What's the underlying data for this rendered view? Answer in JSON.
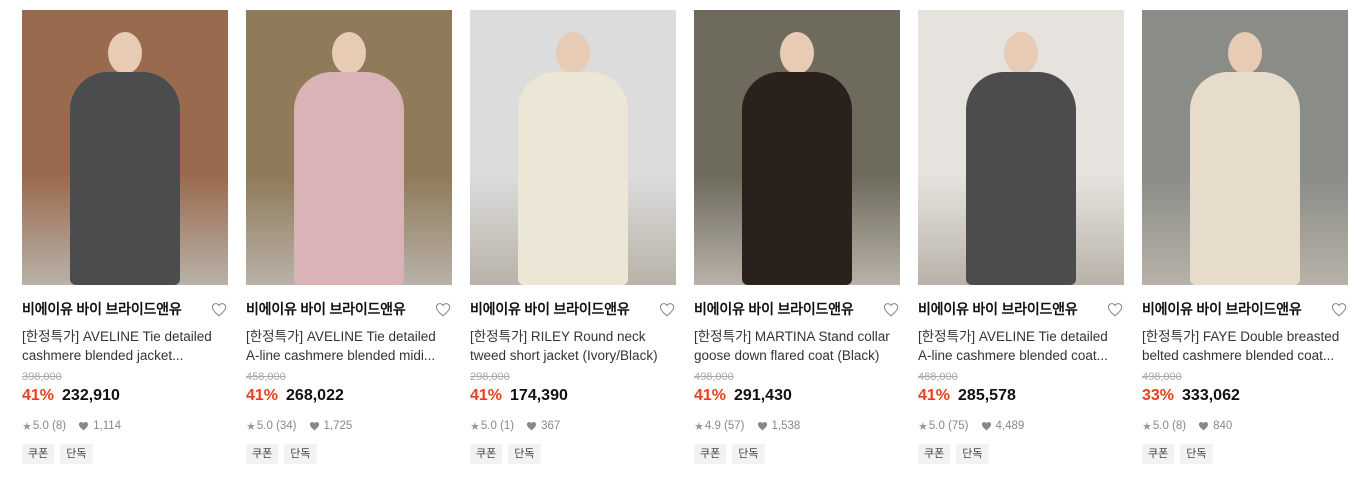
{
  "products": [
    {
      "brand": "비에이유 바이 브라이드앤유",
      "title_line1": "[한정특가] AVELINE Tie detailed",
      "title_line2": "cashmere blended jacket...",
      "original_price": "398,000",
      "discount": "41%",
      "price": "232,910",
      "rating": "5.0 (8)",
      "likes": "1,114",
      "tags": [
        "쿠폰",
        "단독"
      ],
      "coat_color": "#4a4c4e",
      "bg_color": "#9a6a4e"
    },
    {
      "brand": "비에이유 바이 브라이드앤유",
      "title_line1": "[한정특가] AVELINE Tie detailed",
      "title_line2": "A-line cashmere blended midi...",
      "original_price": "458,000",
      "discount": "41%",
      "price": "268,022",
      "rating": "5.0 (34)",
      "likes": "1,725",
      "tags": [
        "쿠폰",
        "단독"
      ],
      "coat_color": "#d9b3b5",
      "bg_color": "#8f7a5a"
    },
    {
      "brand": "비에이유 바이 브라이드앤유",
      "title_line1": "[한정특가] RILEY Round neck",
      "title_line2": "tweed short jacket (Ivory/Black)",
      "original_price": "298,000",
      "discount": "41%",
      "price": "174,390",
      "rating": "5.0 (1)",
      "likes": "367",
      "tags": [
        "쿠폰",
        "단독"
      ],
      "coat_color": "#ece6d6",
      "bg_color": "#dcdcdc"
    },
    {
      "brand": "비에이유 바이 브라이드앤유",
      "title_line1": "[한정특가] MARTINA Stand collar",
      "title_line2": "goose down flared coat (Black)",
      "original_price": "498,000",
      "discount": "41%",
      "price": "291,430",
      "rating": "4.9 (57)",
      "likes": "1,538",
      "tags": [
        "쿠폰",
        "단독"
      ],
      "coat_color": "#2a201c",
      "bg_color": "#6e6a5c"
    },
    {
      "brand": "비에이유 바이 브라이드앤유",
      "title_line1": "[한정특가] AVELINE Tie detailed",
      "title_line2": "A-line cashmere blended coat...",
      "original_price": "488,000",
      "discount": "41%",
      "price": "285,578",
      "rating": "5.0 (75)",
      "likes": "4,489",
      "tags": [
        "쿠폰",
        "단독"
      ],
      "coat_color": "#4c4c4c",
      "bg_color": "#e6e3df"
    },
    {
      "brand": "비에이유 바이 브라이드앤유",
      "title_line1": "[한정특가] FAYE Double breasted",
      "title_line2": "belted cashmere blended coat...",
      "original_price": "498,000",
      "discount": "33%",
      "price": "333,062",
      "rating": "5.0 (8)",
      "likes": "840",
      "tags": [
        "쿠폰",
        "단독"
      ],
      "coat_color": "#e7dccb",
      "bg_color": "#8a8c88"
    }
  ],
  "icons": {
    "wishlist": "heart-outline-icon",
    "rating": "star-icon",
    "likes": "heart-filled-icon"
  },
  "colors": {
    "discount": "#e8401c",
    "tag_bg": "#f2f2f2"
  }
}
